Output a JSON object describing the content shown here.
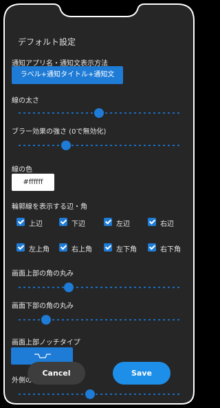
{
  "title": "デフォルト設定",
  "notify_method": {
    "label": "通知アプリ名・通知文表示方法",
    "button": "ラベル+通知タイトル+通知文"
  },
  "line_width": {
    "label": "線の太さ",
    "value": 0.5
  },
  "blur": {
    "label": "ブラー効果の強さ (0で無効化)",
    "value": 0.28
  },
  "line_color": {
    "label": "線の色",
    "value": "#ffffff"
  },
  "edges": {
    "label": "輪郭線を表示する辺・角",
    "items": [
      {
        "label": "上辺",
        "checked": true
      },
      {
        "label": "下辺",
        "checked": true
      },
      {
        "label": "左辺",
        "checked": true
      },
      {
        "label": "右辺",
        "checked": true
      },
      {
        "label": "左上角",
        "checked": true
      },
      {
        "label": "右上角",
        "checked": true
      },
      {
        "label": "左下角",
        "checked": true
      },
      {
        "label": "右下角",
        "checked": true
      }
    ]
  },
  "top_radius": {
    "label": "画面上部の角の丸み",
    "value": 0.3
  },
  "bottom_radius": {
    "label": "画面下部の角の丸み",
    "value": 0.15
  },
  "notch": {
    "label": "画面上部ノッチタイプ"
  },
  "outer": {
    "label": "外側の",
    "value": 0.44
  },
  "buttons": {
    "cancel": "Cancel",
    "save": "Save"
  },
  "colors": {
    "accent": "#1e7bd6",
    "panel": "#262626",
    "cancel_bg": "#3d3d3d"
  }
}
